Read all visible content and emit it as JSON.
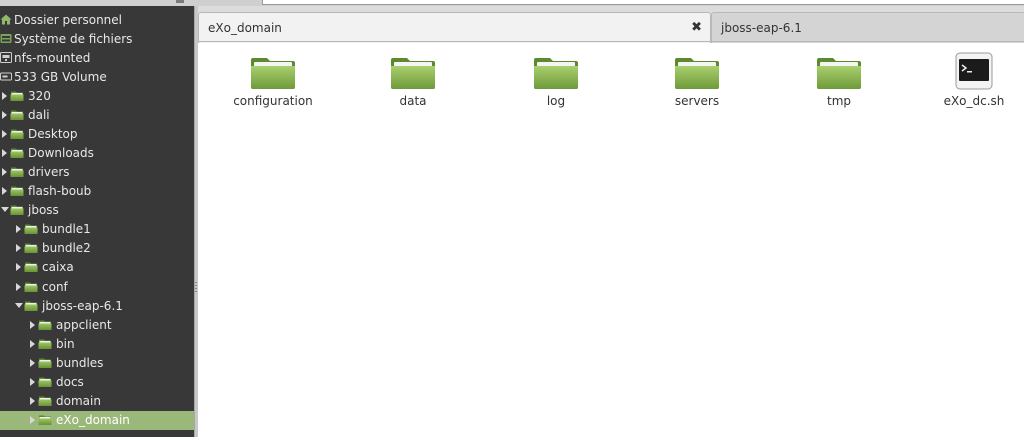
{
  "sidebar": {
    "places": [
      {
        "label": "Dossier personnel",
        "icon": "home-icon"
      },
      {
        "label": "Système de fichiers",
        "icon": "filesystem-icon"
      },
      {
        "label": "nfs-mounted",
        "icon": "network-drive-icon"
      },
      {
        "label": "533 GB Volume",
        "icon": "drive-icon"
      }
    ],
    "tree": [
      {
        "label": "320",
        "level": 0,
        "expanded": false
      },
      {
        "label": "dali",
        "level": 0,
        "expanded": false
      },
      {
        "label": "Desktop",
        "level": 0,
        "expanded": false
      },
      {
        "label": "Downloads",
        "level": 0,
        "expanded": false
      },
      {
        "label": "drivers",
        "level": 0,
        "expanded": false
      },
      {
        "label": "flash-boub",
        "level": 0,
        "expanded": false
      },
      {
        "label": "jboss",
        "level": 0,
        "expanded": true
      },
      {
        "label": "bundle1",
        "level": 1,
        "expanded": false
      },
      {
        "label": "bundle2",
        "level": 1,
        "expanded": false
      },
      {
        "label": "caixa",
        "level": 1,
        "expanded": false
      },
      {
        "label": "conf",
        "level": 1,
        "expanded": false
      },
      {
        "label": "jboss-eap-6.1",
        "level": 1,
        "expanded": true
      },
      {
        "label": "appclient",
        "level": 2,
        "expanded": false
      },
      {
        "label": "bin",
        "level": 2,
        "expanded": false
      },
      {
        "label": "bundles",
        "level": 2,
        "expanded": false
      },
      {
        "label": "docs",
        "level": 2,
        "expanded": false
      },
      {
        "label": "domain",
        "level": 2,
        "expanded": false
      },
      {
        "label": "eXo_domain",
        "level": 2,
        "expanded": false,
        "selected": true
      }
    ]
  },
  "tabs": [
    {
      "label": "eXo_domain",
      "active": true,
      "close_glyph": "✖"
    },
    {
      "label": "jboss-eap-6.1",
      "active": false
    }
  ],
  "files": [
    {
      "name": "configuration",
      "icon": "folder-icon"
    },
    {
      "name": "data",
      "icon": "folder-icon"
    },
    {
      "name": "log",
      "icon": "folder-icon"
    },
    {
      "name": "servers",
      "icon": "folder-icon"
    },
    {
      "name": "tmp",
      "icon": "folder-icon"
    },
    {
      "name": "eXo_dc.sh",
      "icon": "terminal-script-icon"
    }
  ],
  "colors": {
    "sidebar_bg": "#383838",
    "selection": "#9ab87a",
    "folder_green": "#8ab44f"
  }
}
